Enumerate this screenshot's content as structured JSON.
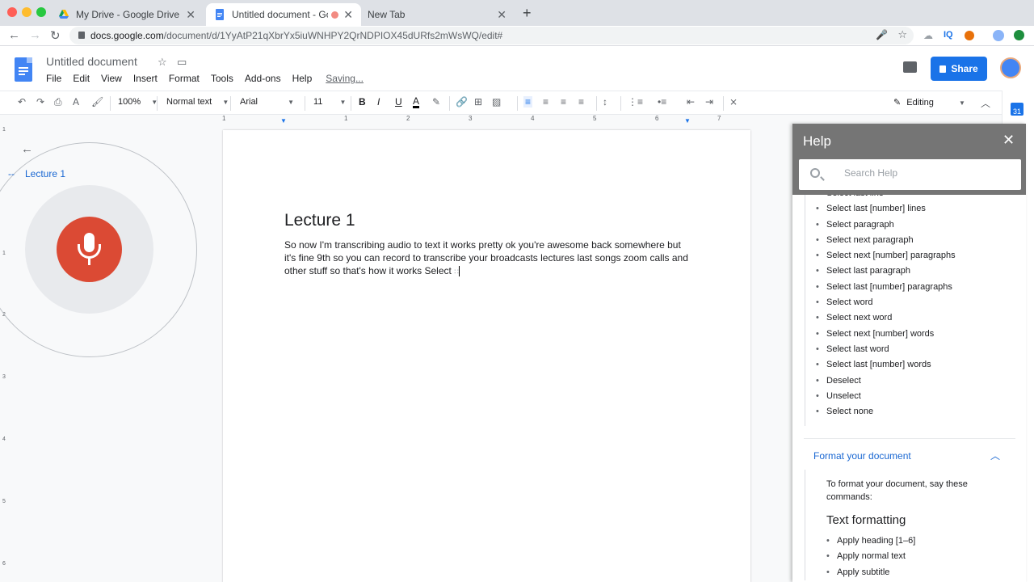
{
  "browser": {
    "tabs": [
      {
        "title": "My Drive - Google Drive"
      },
      {
        "title": "Untitled document - Googl"
      },
      {
        "title": "New Tab"
      }
    ],
    "url_host": "docs.google.com",
    "url_path": "/document/d/1YyAtP21qXbrYx5iuWNHPY2QrNDPIOX45dURfs2mWsWQ/edit#"
  },
  "docs": {
    "title": "Untitled document",
    "menu": [
      "File",
      "Edit",
      "View",
      "Insert",
      "Format",
      "Tools",
      "Add-ons",
      "Help"
    ],
    "saving_status": "Saving...",
    "share_label": "Share"
  },
  "toolbar": {
    "zoom": "100%",
    "style": "Normal text",
    "font": "Arial",
    "font_size": "11",
    "mode": "Editing"
  },
  "ruler": {
    "h_ticks": [
      "1",
      "1",
      "2",
      "3",
      "4",
      "5",
      "6",
      "7"
    ],
    "v_ticks": [
      "1",
      "1",
      "2",
      "3",
      "4",
      "5",
      "6"
    ]
  },
  "document": {
    "heading": "Lecture 1",
    "body": "So now I'm transcribing audio to text it works pretty ok you're awesome back somewhere but it's fine 9th so you can record to transcribe your broadcasts lectures last songs zoom calls and other stuff so that's how it works Select"
  },
  "voice": {
    "label": "Lecture 1"
  },
  "help": {
    "title": "Help",
    "search_placeholder": "Search Help",
    "commands": [
      "Select last line",
      "Select last [number] lines",
      "Select paragraph",
      "Select next paragraph",
      "Select next [number] paragraphs",
      "Select last paragraph",
      "Select last [number] paragraphs",
      "Select word",
      "Select next word",
      "Select next [number] words",
      "Select last word",
      "Select last [number] words",
      "Deselect",
      "Unselect",
      "Select none"
    ],
    "section_title": "Format your document",
    "section_intro": "To format your document, say these commands:",
    "section_heading": "Text formatting",
    "section_commands": [
      "Apply heading [1–6]",
      "Apply normal text",
      "Apply subtitle"
    ]
  }
}
